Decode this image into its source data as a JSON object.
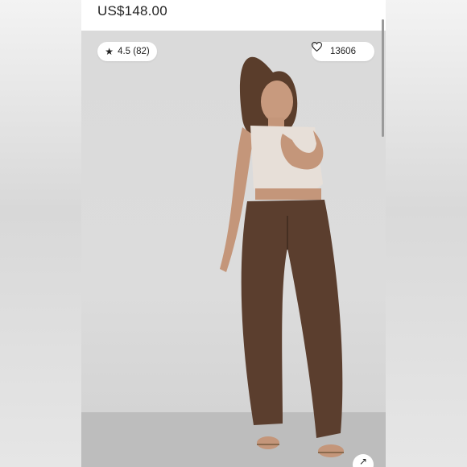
{
  "product": {
    "price": "US$148.00"
  },
  "rating": {
    "star_glyph": "★",
    "text": "4.5 (82)"
  },
  "favorites": {
    "count": "13606",
    "icon": "heart-icon"
  },
  "expand": {
    "glyph": "↗",
    "icon": "expand-icon"
  },
  "colors": {
    "background": "#ececec",
    "pants": "#5b3e2e",
    "top": "#e7dfd8"
  }
}
